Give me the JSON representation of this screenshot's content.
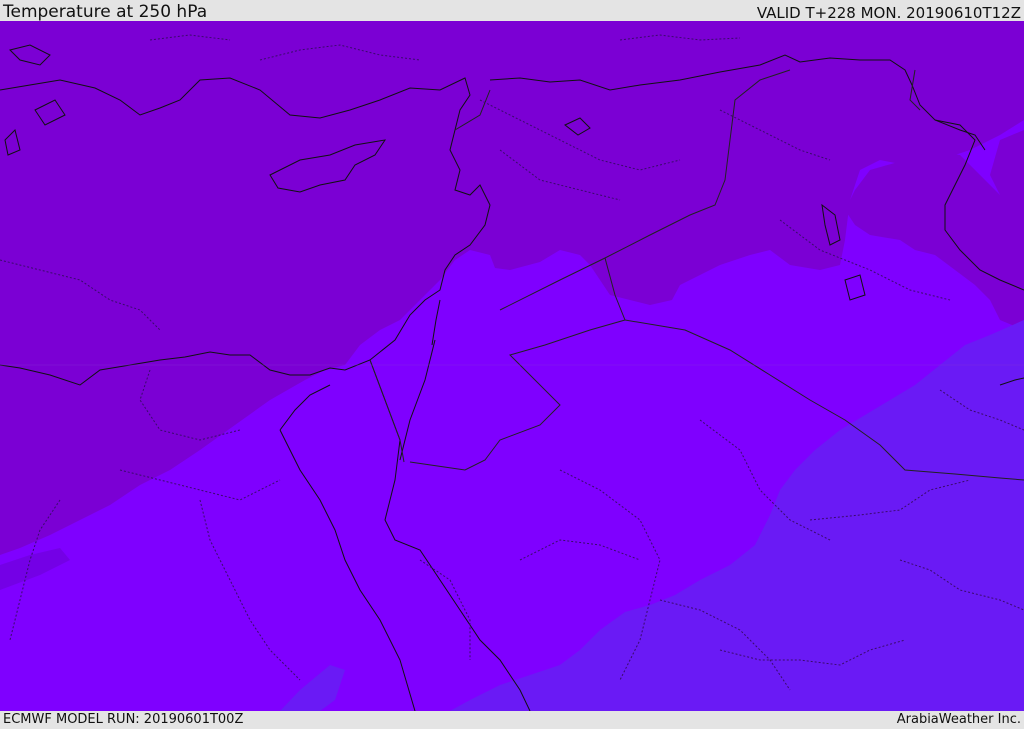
{
  "header": {
    "title": "Temperature at 250 hPa",
    "valid_time": "VALID T+228 MON. 20190610T12Z"
  },
  "footer": {
    "model_run": "ECMWF MODEL RUN: 20190601T00Z",
    "credit": "ArabiaWeather Inc."
  },
  "map": {
    "variable": "Temperature",
    "level": "250 hPa",
    "colors": {
      "warmest": "#7b00d4",
      "middle": "#7f00ff",
      "coldest": "#6a1af5",
      "coast_line": "#111111",
      "border_line": "#222222"
    }
  }
}
